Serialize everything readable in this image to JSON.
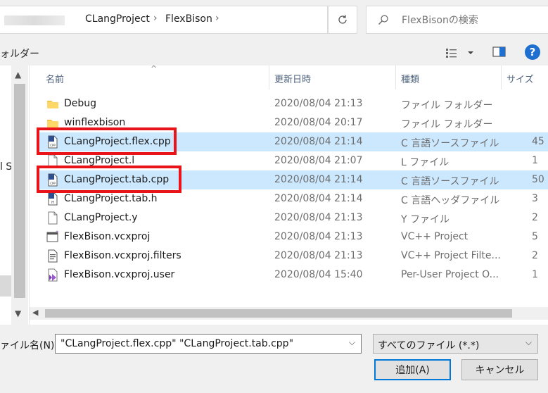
{
  "address_bar": {
    "breadcrumbs": [
      "CLangProject",
      "FlexBison"
    ],
    "separator": "›",
    "chevron": "›"
  },
  "search": {
    "placeholder": "FlexBisonの検索",
    "icon": "search-icon"
  },
  "toolbar": {
    "new_folder_partial": "ォルダー",
    "help": "?"
  },
  "left_pane": {
    "partial_text": "l S"
  },
  "columns": {
    "name": "名前",
    "date": "更新日時",
    "type": "種類",
    "size": "サイズ"
  },
  "files": [
    {
      "name": "Debug",
      "date": "2020/08/04 21:13",
      "type": "ファイル フォルダー",
      "size": "",
      "icon": "folder-icon",
      "selected": false
    },
    {
      "name": "winflexbison",
      "date": "2020/08/04 20:17",
      "type": "ファイル フォルダー",
      "size": "",
      "icon": "folder-icon",
      "selected": false
    },
    {
      "name": "CLangProject.flex.cpp",
      "date": "2020/08/04 21:14",
      "type": "C 言語ソースファイル",
      "size": "45",
      "icon": "cpp-file-icon",
      "selected": true
    },
    {
      "name": "CLangProject.l",
      "date": "2020/08/04 21:07",
      "type": "L ファイル",
      "size": "1",
      "icon": "blank-file-icon",
      "selected": false
    },
    {
      "name": "CLangProject.tab.cpp",
      "date": "2020/08/04 21:14",
      "type": "C 言語ソースファイル",
      "size": "50",
      "icon": "cpp-file-icon",
      "selected": true
    },
    {
      "name": "CLangProject.tab.h",
      "date": "2020/08/04 21:14",
      "type": "C 言語ヘッダファイル",
      "size": "3",
      "icon": "header-file-icon",
      "selected": false
    },
    {
      "name": "CLangProject.y",
      "date": "2020/08/04 21:13",
      "type": "Y ファイル",
      "size": "2",
      "icon": "blank-file-icon",
      "selected": false
    },
    {
      "name": "FlexBison.vcxproj",
      "date": "2020/08/04 21:13",
      "type": "VC++ Project",
      "size": "5",
      "icon": "vcxproj-icon",
      "selected": false
    },
    {
      "name": "FlexBison.vcxproj.filters",
      "date": "2020/08/04 21:13",
      "type": "VC++ Project Filte...",
      "size": "2",
      "icon": "filters-file-icon",
      "selected": false
    },
    {
      "name": "FlexBison.vcxproj.user",
      "date": "2020/08/04 15:40",
      "type": "Per-User Project O...",
      "size": "1",
      "icon": "user-project-icon",
      "selected": false
    }
  ],
  "bottom": {
    "filename_label": "ァイル名(N):",
    "filename_value": "\"CLangProject.flex.cpp\" \"CLangProject.tab.cpp\"",
    "filetype_value": "すべてのファイル (*.*)",
    "add_button": "追加(A)",
    "cancel_button": "キャンセル"
  },
  "colors": {
    "selection": "#cce8ff",
    "highlight_box": "#e8141a",
    "help_icon": "#1e6fd0",
    "primary_button_border": "#0078d7"
  }
}
